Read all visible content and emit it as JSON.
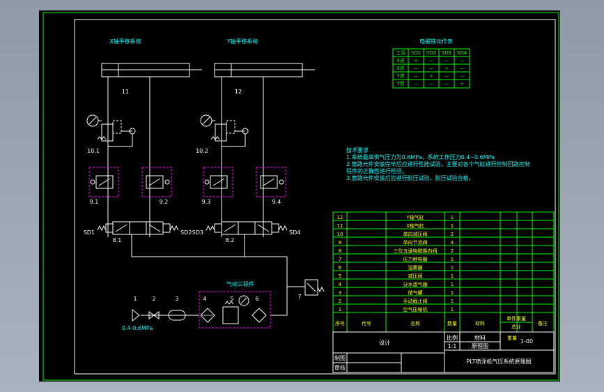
{
  "titles": {
    "x_system": "X轴平移系统",
    "y_system": "Y轴平移系统",
    "solenoid_table": "电磁铁动作表",
    "frl_unit": "气动三联件"
  },
  "labels": {
    "cyl_x": "11",
    "cyl_y": "12",
    "reg_x": "10.1",
    "reg_y": "10.2",
    "fc_91": "9.1",
    "fc_92": "9.2",
    "fc_93": "9.3",
    "fc_94": "9.4",
    "valve_81": "8.1",
    "valve_82": "8.2",
    "sd1": "SD1",
    "sd2": "SD2",
    "sd3": "SD3",
    "sd4": "SD4",
    "n1": "1",
    "n2": "2",
    "n3": "3",
    "n4": "4",
    "n5": "5",
    "n6": "6",
    "n7": "7",
    "pressure": "0.4-0.6MPa"
  },
  "solenoid_table": {
    "headers": [
      "工况",
      "SD1",
      "SD2",
      "SD3",
      "SD4"
    ],
    "rows": [
      [
        "X进",
        "+",
        "—",
        "—",
        "—"
      ],
      [
        "X退",
        "—",
        "—",
        "+",
        "—"
      ],
      [
        "Y进",
        "—",
        "+",
        "—",
        "—"
      ],
      [
        "Y退",
        "—",
        "—",
        "—",
        "+"
      ]
    ]
  },
  "notes": {
    "title": "技术要求",
    "lines": [
      "1.系统最高供气压力为0.6MPa，系统工作压力0.4~0.6MPa",
      "2.管路元件安装完毕后应进行性能试验，主要对各个气缸进行控制回路控制",
      "  程序的正确性进行检验，",
      "3.管路元件安装后应进行耐压试验，耐压试验合格。"
    ]
  },
  "parts": {
    "rows": [
      [
        "12",
        "",
        "Y轴气缸",
        "1",
        "",
        "",
        ""
      ],
      [
        "11",
        "",
        "X轴气缸",
        "1",
        "",
        "",
        ""
      ],
      [
        "10",
        "",
        "单向减压阀",
        "2",
        "",
        "",
        ""
      ],
      [
        "9",
        "",
        "单向节流阀",
        "4",
        "",
        "",
        ""
      ],
      [
        "8",
        "",
        "三位五通电磁换向阀",
        "2",
        "",
        "",
        ""
      ],
      [
        "7",
        "",
        "压力继电器",
        "1",
        "",
        "",
        ""
      ],
      [
        "6",
        "",
        "油雾器",
        "1",
        "",
        "",
        ""
      ],
      [
        "5",
        "",
        "减压阀",
        "1",
        "",
        "",
        ""
      ],
      [
        "4",
        "",
        "分水滤气器",
        "1",
        "",
        "",
        ""
      ],
      [
        "3",
        "",
        "储气罐",
        "1",
        "",
        "",
        ""
      ],
      [
        "2",
        "",
        "手动截止阀",
        "1",
        "",
        "",
        ""
      ],
      [
        "1",
        "",
        "空气压缩机",
        "1",
        "",
        "",
        ""
      ]
    ],
    "header": [
      "序号",
      "代号",
      "名称",
      "数量",
      "材料",
      "单件重量",
      "备注"
    ],
    "header_sub": [
      "",
      "",
      "",
      "",
      "",
      "总计",
      ""
    ]
  },
  "title_block": {
    "design": "设计",
    "scale_label": "比例",
    "material_label": "材料",
    "scale": "1:1",
    "drawing_type": "原理图",
    "weight_label": "重量",
    "weight": "1-00",
    "draw_label": "制图",
    "check_label": "审核",
    "drawing_title": "PLT喷涂机气压系统原理图"
  },
  "colors": {
    "background": "#000000",
    "frame": "#00ff00",
    "lines": "#ffffff",
    "text_cyan": "#00ffff",
    "text_yellow": "#ffff00",
    "group": "#ff00ff"
  }
}
